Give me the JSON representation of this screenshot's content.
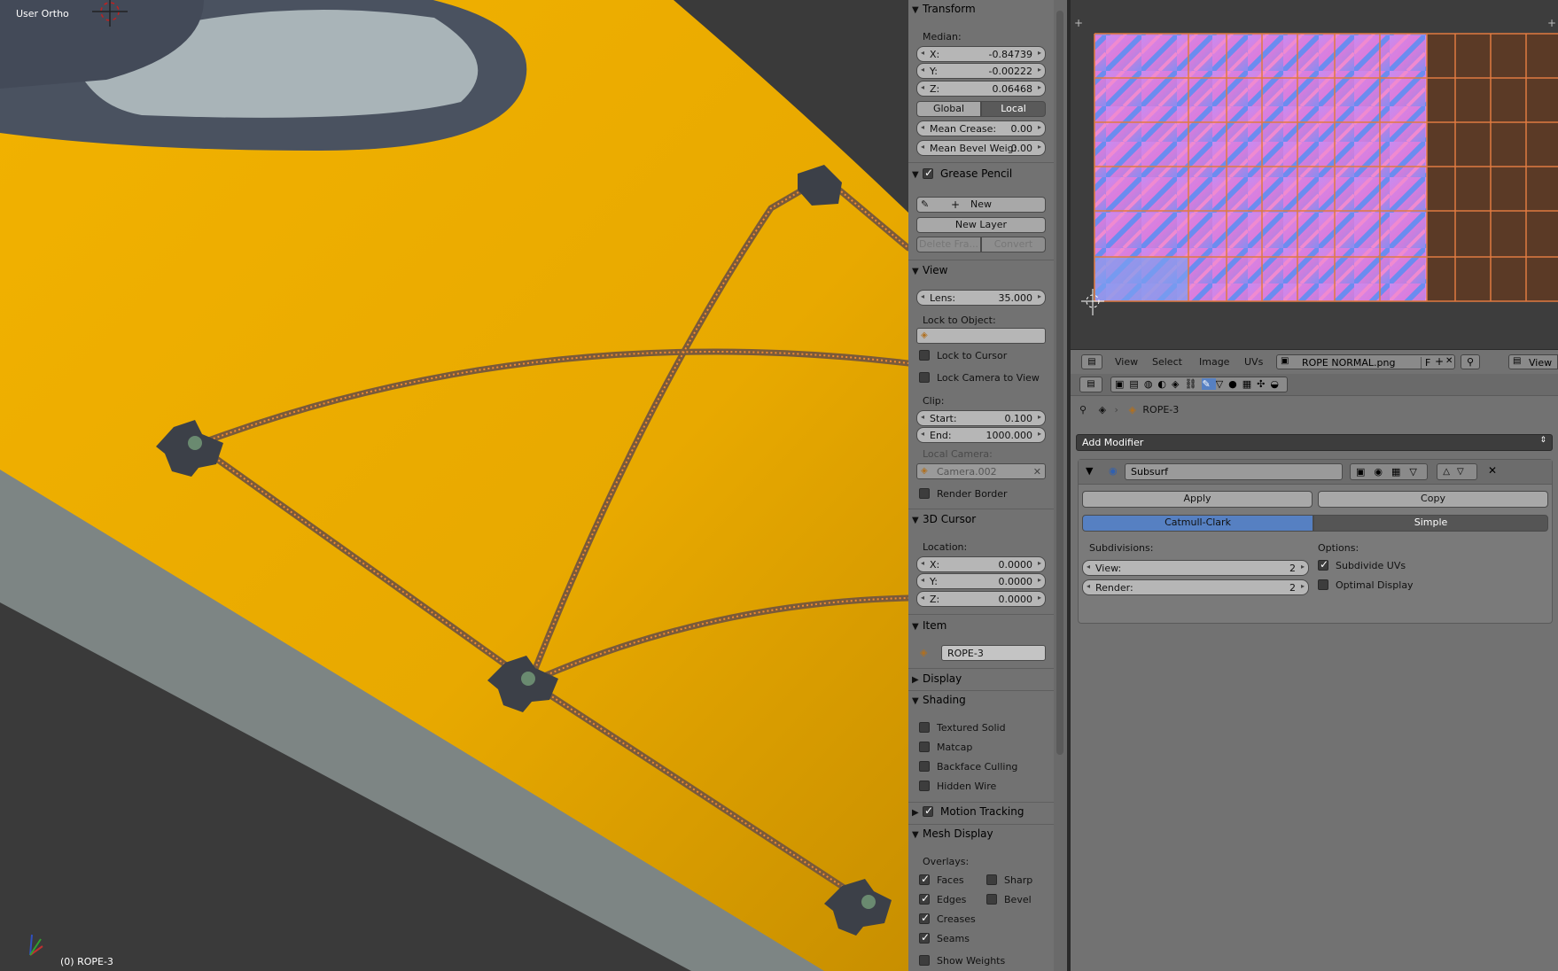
{
  "viewport": {
    "view_label": "User Ortho",
    "object_label": "(0) ROPE-3",
    "colors": {
      "kayak": "#f0b400",
      "rope": "#e07020",
      "background": "#3a3a3a"
    }
  },
  "npanel": {
    "transform": {
      "title": "Transform",
      "median_label": "Median:",
      "x_label": "X:",
      "x": "-0.84739",
      "y_label": "Y:",
      "y": "-0.00222",
      "z_label": "Z:",
      "z": "0.06468",
      "global": "Global",
      "local": "Local",
      "crease_label": "Mean Crease:",
      "crease": "0.00",
      "bevel_label": "Mean Bevel Weig:",
      "bevel": "0.00"
    },
    "grease_pencil": {
      "title": "Grease Pencil",
      "new": "New",
      "new_layer": "New Layer",
      "delete_frame": "Delete Fra...",
      "convert": "Convert"
    },
    "view": {
      "title": "View",
      "lens_label": "Lens:",
      "lens": "35.000",
      "lock_object": "Lock to Object:",
      "lock_cursor": "Lock to Cursor",
      "lock_camera": "Lock Camera to View",
      "clip": "Clip:",
      "start_label": "Start:",
      "start": "0.100",
      "end_label": "End:",
      "end": "1000.000",
      "local_camera": "Local Camera:",
      "camera": "Camera.002",
      "render_border": "Render Border"
    },
    "cursor": {
      "title": "3D Cursor",
      "location": "Location:",
      "x_label": "X:",
      "x": "0.0000",
      "y_label": "Y:",
      "y": "0.0000",
      "z_label": "Z:",
      "z": "0.0000"
    },
    "item": {
      "title": "Item",
      "name": "ROPE-3"
    },
    "display": {
      "title": "Display"
    },
    "shading": {
      "title": "Shading",
      "textured_solid": "Textured Solid",
      "matcap": "Matcap",
      "backface": "Backface Culling",
      "hidden_wire": "Hidden Wire"
    },
    "motion_tracking": {
      "title": "Motion Tracking"
    },
    "mesh_display": {
      "title": "Mesh Display",
      "overlays": "Overlays:",
      "faces": "Faces",
      "sharp": "Sharp",
      "edges": "Edges",
      "bevel": "Bevel",
      "creases": "Creases",
      "seams": "Seams",
      "show_weights": "Show Weights"
    }
  },
  "uv_header": {
    "menus": [
      "View",
      "Select",
      "Image",
      "UVs"
    ],
    "image_name": "ROPE NORMAL.png",
    "f_label": "F",
    "view_label": "View"
  },
  "properties": {
    "object_name": "ROPE-3",
    "add_modifier": "Add Modifier",
    "modifier_name": "Subsurf",
    "apply": "Apply",
    "copy": "Copy",
    "catmull": "Catmull-Clark",
    "simple": "Simple",
    "subdivisions": "Subdivisions:",
    "view_label": "View:",
    "view": "2",
    "render_label": "Render:",
    "render": "2",
    "options": "Options:",
    "subdivide_uvs": "Subdivide UVs",
    "optimal_display": "Optimal Display"
  }
}
